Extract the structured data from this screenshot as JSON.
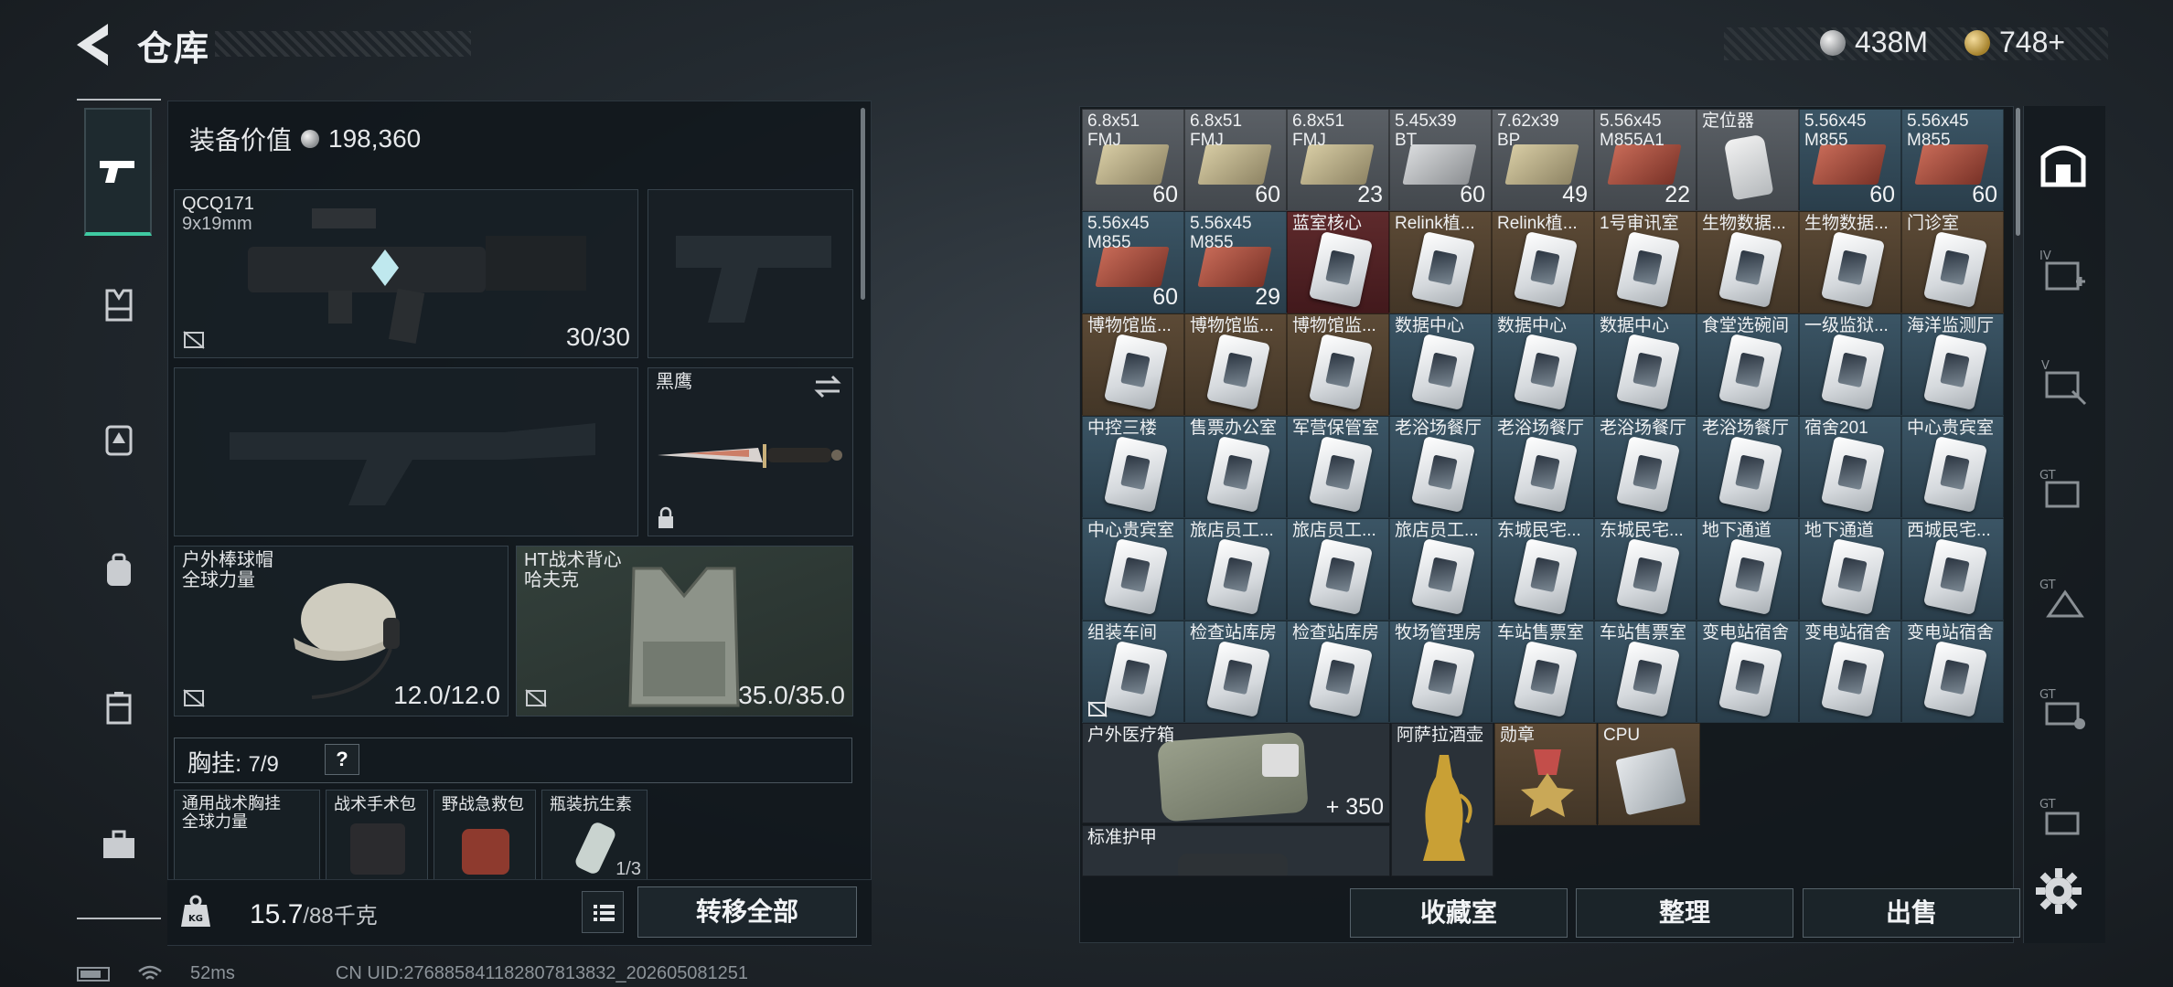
{
  "header": {
    "title": "仓库",
    "currency_silver": "438M",
    "currency_gold": "748+"
  },
  "sidebar": {
    "items": [
      {
        "icon": "pistol-icon",
        "active": true
      },
      {
        "icon": "armor-vest-icon"
      },
      {
        "icon": "backpack-id-icon"
      },
      {
        "icon": "backpack-icon"
      },
      {
        "icon": "container-icon"
      },
      {
        "icon": "toolbox-icon"
      }
    ]
  },
  "equipment": {
    "value_label": "装备价值",
    "value": "198,360",
    "primary_weapon": {
      "name": "QCQ171",
      "caliber": "9x19mm",
      "durability": "30/30"
    },
    "knife": {
      "name": "黑鹰"
    },
    "helmet": {
      "name": "户外棒球帽",
      "sub": "全球力量",
      "durability": "12.0/12.0"
    },
    "armor": {
      "name": "HT战术背心",
      "sub": "哈夫克",
      "durability": "35.0/35.0"
    },
    "chest_rig_label": "胸挂:",
    "chest_rig_capacity": "7/9",
    "help": "?",
    "chest_items": [
      {
        "name": "通用战术胸挂",
        "sub": "全球力量"
      },
      {
        "name": "战术手术包"
      },
      {
        "name": "野战急救包"
      },
      {
        "name": "瓶装抗生素",
        "count": "1/3"
      }
    ]
  },
  "footer_left": {
    "weight": "15.7",
    "weight_max": "/88千克",
    "transfer_all": "转移全部"
  },
  "stash": {
    "cells": [
      {
        "name": "6.8x51\nFMJ",
        "count": "60",
        "color": "gray",
        "type": "ammo-tan"
      },
      {
        "name": "6.8x51\nFMJ",
        "count": "60",
        "color": "gray",
        "type": "ammo-tan"
      },
      {
        "name": "6.8x51\nFMJ",
        "count": "23",
        "color": "gray",
        "type": "ammo-tan"
      },
      {
        "name": "5.45x39\nBT",
        "count": "60",
        "color": "gray",
        "type": "ammo-silv"
      },
      {
        "name": "7.62x39\nBP",
        "count": "49",
        "color": "gray",
        "type": "ammo-tan"
      },
      {
        "name": "5.56x45\nM855A1",
        "count": "22",
        "color": "gray",
        "type": "ammo-red"
      },
      {
        "name": "定位器",
        "count": "",
        "color": "gray",
        "type": "tag"
      },
      {
        "name": "5.56x45\nM855",
        "count": "60",
        "color": "blue",
        "type": "ammo-red"
      },
      {
        "name": "5.56x45\nM855",
        "count": "60",
        "color": "blue",
        "type": "ammo-red"
      },
      {
        "name": "5.56x45\nM855",
        "count": "60",
        "color": "blue",
        "type": "ammo-red"
      },
      {
        "name": "5.56x45\nM855",
        "count": "29",
        "color": "blue",
        "type": "ammo-red"
      },
      {
        "name": "蓝室核心",
        "count": "",
        "color": "red",
        "type": "card"
      },
      {
        "name": "Relink植...",
        "count": "",
        "color": "orange",
        "type": "card"
      },
      {
        "name": "Relink植...",
        "count": "",
        "color": "orange",
        "type": "card"
      },
      {
        "name": "1号审讯室",
        "count": "",
        "color": "orange",
        "type": "card"
      },
      {
        "name": "生物数据...",
        "count": "",
        "color": "orange",
        "type": "card"
      },
      {
        "name": "生物数据...",
        "count": "",
        "color": "orange",
        "type": "card"
      },
      {
        "name": "门诊室",
        "count": "",
        "color": "orange",
        "type": "card"
      },
      {
        "name": "博物馆监...",
        "count": "",
        "color": "orange",
        "type": "card"
      },
      {
        "name": "博物馆监...",
        "count": "",
        "color": "orange",
        "type": "card"
      },
      {
        "name": "博物馆监...",
        "count": "",
        "color": "orange",
        "type": "card"
      },
      {
        "name": "数据中心",
        "count": "",
        "color": "blue",
        "type": "card"
      },
      {
        "name": "数据中心",
        "count": "",
        "color": "blue",
        "type": "card"
      },
      {
        "name": "数据中心",
        "count": "",
        "color": "blue",
        "type": "card"
      },
      {
        "name": "食堂选碗间",
        "count": "",
        "color": "blue",
        "type": "card"
      },
      {
        "name": "一级监狱...",
        "count": "",
        "color": "blue",
        "type": "card"
      },
      {
        "name": "海洋监测厅",
        "count": "",
        "color": "blue",
        "type": "card"
      },
      {
        "name": "中控三楼",
        "count": "",
        "color": "blue",
        "type": "card"
      },
      {
        "name": "售票办公室",
        "count": "",
        "color": "blue",
        "type": "card"
      },
      {
        "name": "军营保管室",
        "count": "",
        "color": "blue",
        "type": "card"
      },
      {
        "name": "老浴场餐厅",
        "count": "",
        "color": "blue",
        "type": "card"
      },
      {
        "name": "老浴场餐厅",
        "count": "",
        "color": "blue",
        "type": "card"
      },
      {
        "name": "老浴场餐厅",
        "count": "",
        "color": "blue",
        "type": "card"
      },
      {
        "name": "老浴场餐厅",
        "count": "",
        "color": "blue",
        "type": "card"
      },
      {
        "name": "宿舍201",
        "count": "",
        "color": "blue",
        "type": "card"
      },
      {
        "name": "中心贵宾室",
        "count": "",
        "color": "blue",
        "type": "card"
      },
      {
        "name": "中心贵宾室",
        "count": "",
        "color": "blue",
        "type": "card"
      },
      {
        "name": "旅店员工...",
        "count": "",
        "color": "blue",
        "type": "card"
      },
      {
        "name": "旅店员工...",
        "count": "",
        "color": "blue",
        "type": "card"
      },
      {
        "name": "旅店员工...",
        "count": "",
        "color": "blue",
        "type": "card"
      },
      {
        "name": "东城民宅...",
        "count": "",
        "color": "blue",
        "type": "card"
      },
      {
        "name": "东城民宅...",
        "count": "",
        "color": "blue",
        "type": "card"
      },
      {
        "name": "地下通道",
        "count": "",
        "color": "blue",
        "type": "card"
      },
      {
        "name": "地下通道",
        "count": "",
        "color": "blue",
        "type": "card"
      },
      {
        "name": "西城民宅...",
        "count": "",
        "color": "blue",
        "type": "card"
      },
      {
        "name": "组装车间",
        "count": "",
        "color": "blue",
        "type": "card"
      },
      {
        "name": "检查站库房",
        "count": "",
        "color": "blue",
        "type": "card"
      },
      {
        "name": "检查站库房",
        "count": "",
        "color": "blue",
        "type": "card"
      },
      {
        "name": "牧场管理房",
        "count": "",
        "color": "blue",
        "type": "card"
      },
      {
        "name": "车站售票室",
        "count": "",
        "color": "blue",
        "type": "card"
      },
      {
        "name": "车站售票室",
        "count": "",
        "color": "blue",
        "type": "card"
      },
      {
        "name": "变电站宿舍",
        "count": "",
        "color": "blue",
        "type": "card"
      },
      {
        "name": "变电站宿舍",
        "count": "",
        "color": "blue",
        "type": "card"
      },
      {
        "name": "变电站宿舍",
        "count": "",
        "color": "blue",
        "type": "card"
      }
    ],
    "bottom_items": {
      "medkit": {
        "name": "户外医疗箱",
        "count": "350"
      },
      "pot": {
        "name": "阿萨拉酒壶"
      },
      "medal": {
        "name": "勋章"
      },
      "cpu": {
        "name": "CPU"
      },
      "armor": {
        "name": "标准护甲"
      }
    }
  },
  "actions": {
    "collection": "收藏室",
    "organize": "整理",
    "sell": "出售"
  },
  "status_bar": {
    "ping": "52ms",
    "uid": "CN UID:276885841182807813832_202605081251"
  },
  "colors": {
    "accent": "#3fcaa2",
    "gray_cell": "#50555b",
    "blue_cell": "#33495a",
    "orange_cell": "#4f3f2f",
    "red_cell": "#4f2224"
  }
}
